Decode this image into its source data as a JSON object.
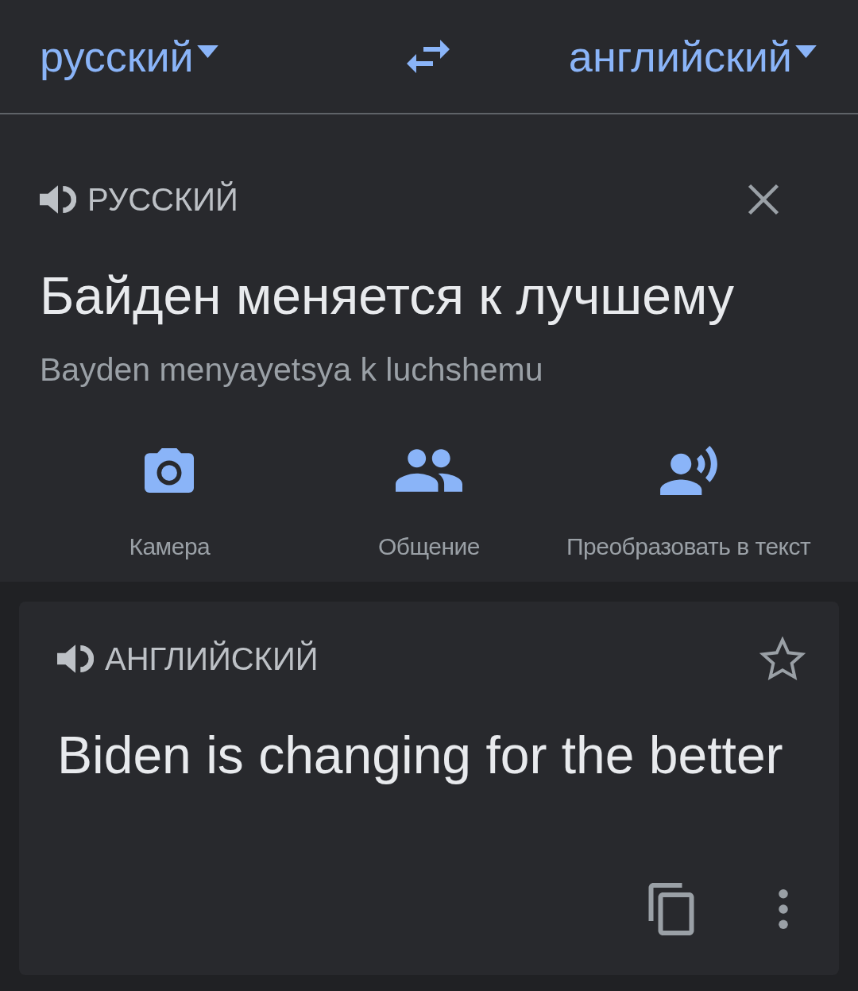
{
  "language_bar": {
    "source_language": "русский",
    "target_language": "английский"
  },
  "source": {
    "language_label": "РУССКИЙ",
    "text": "Байден меняется к лучшему",
    "transliteration": "Bayden menyayetsya k luchshemu"
  },
  "actions": [
    {
      "kind": "camera",
      "label": "Камера"
    },
    {
      "kind": "conversation",
      "label": "Общение"
    },
    {
      "kind": "transcribe",
      "label": "Преобразовать в текст"
    }
  ],
  "translation": {
    "language_label": "АНГЛИЙСКИЙ",
    "starred": false,
    "text": "Biden is changing for the better"
  }
}
